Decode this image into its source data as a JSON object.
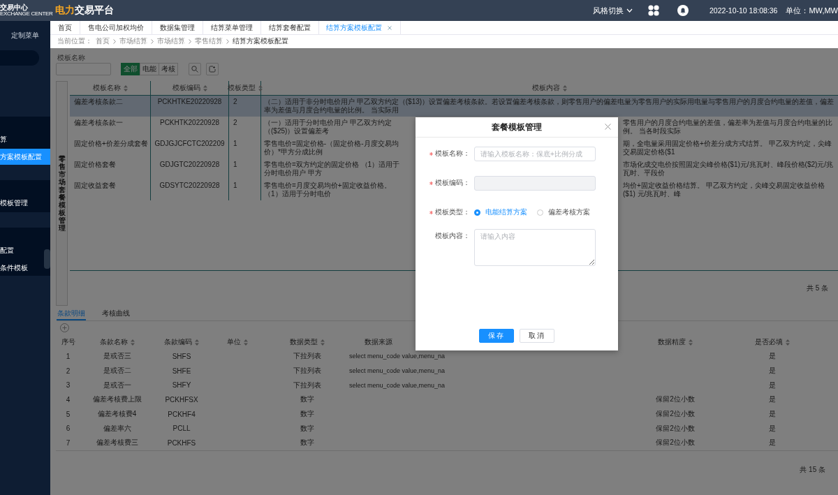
{
  "header": {
    "logo_mark": "交易中心",
    "logo_sub": "EXCHANGE CENTER",
    "brand_highlight": "电力",
    "brand": "交易平台",
    "style_switch": "风格切换",
    "datetime": "2022-10-10 18:08:36",
    "unit": "单位：MW,MW"
  },
  "sidebar": {
    "title": "定制菜单",
    "items": [
      {
        "label": "算",
        "kind": "group",
        "selected": false
      },
      {
        "label": "方案模板配置",
        "kind": "item",
        "selected": true
      },
      {
        "label": "模板管理",
        "kind": "group",
        "selected": false
      },
      {
        "label": "配置",
        "kind": "group",
        "selected": false
      },
      {
        "label": "条件模板",
        "kind": "item",
        "selected": false
      }
    ]
  },
  "tabs": [
    {
      "label": "首页",
      "selected": false,
      "closable": false
    },
    {
      "label": "售电公司加权均价",
      "selected": false,
      "closable": false
    },
    {
      "label": "数据集管理",
      "selected": false,
      "closable": false
    },
    {
      "label": "结算菜单管理",
      "selected": false,
      "closable": false
    },
    {
      "label": "结算套餐配置",
      "selected": false,
      "closable": false
    },
    {
      "label": "结算方案模板配置",
      "selected": true,
      "closable": true
    }
  ],
  "breadcrumb": {
    "label": "当前位置：",
    "items": [
      "首页",
      "市场结算",
      "市场结算",
      "零售结算",
      "结算方案模板配置"
    ]
  },
  "filter": {
    "name_label": "模板名称",
    "type_options": [
      {
        "label": "全部",
        "selected": true
      },
      {
        "label": "电能",
        "selected": false
      },
      {
        "label": "考核",
        "selected": false
      }
    ]
  },
  "template_table": {
    "side_label": "零售市场套餐模板管理",
    "columns": [
      "模板名称",
      "模板编码",
      "模板类型",
      "模板内容"
    ],
    "rows": [
      {
        "name": "偏差考核条款二",
        "code": "PCKHTKE20220928",
        "type": "2",
        "content_start": "（二）适用于非分时电价用户 甲乙双方约定（($13)）设置偏差考核条款。若设置偏差考核条款，则零售用户的偏差电量为零售用户的实际用电量与零售用户的月度合约电量的差值，偏差率为差值与月度合约电量的比例。 当实际用",
        "selected": true
      },
      {
        "name": "偏差考核条款一",
        "code": "PCKHTK20220928",
        "type": "2",
        "content_start": "（一）适用于分时电价用户 甲乙双方约定（($25)）设置偏差考",
        "content_end": "零售用户的月度合约电量的差值，偏差率为差值与月度合约电量的比例。 当各时段实际",
        "selected": false
      },
      {
        "name": "固定价格+价差分成套餐",
        "code": "GDJGJCFCTC202209",
        "type": "1",
        "content_start": "零售电价=固定价格-（固定价格-月度交易均价）*甲方分成比例",
        "content_end": "期，全电量采用固定价格+价差分成方式结算。 甲乙双方约定，尖峰交易固定价格($1",
        "selected": false
      },
      {
        "name": "固定价格套餐",
        "code": "GDJGTC20220928",
        "type": "1",
        "content_start": "零售电价=双方约定的固定价格 （1）适用于分时电价用户 甲方",
        "content_end": "市场化成交电价按照固定尖峰价格($1)元/兆瓦时、峰段价格($2)元/兆瓦时、平段价",
        "selected": false
      },
      {
        "name": "固定收益套餐",
        "code": "GDSYTC20220928",
        "type": "1",
        "content_start": "零售电价=月度交易均价+固定收益价格。（1）适用于分时电价",
        "content_end": "均价+固定收益价格结算。 甲乙双方约定，尖峰交易固定收益价格 ($1) 元/兆瓦时、峰",
        "selected": false
      }
    ],
    "total": "共 5 条"
  },
  "detail_tabs": [
    {
      "label": "条款明细",
      "selected": true
    },
    {
      "label": "考核曲线",
      "selected": false
    }
  ],
  "clause_table": {
    "columns": [
      "序号",
      "条款名称",
      "条款编码",
      "单位",
      "数据类型",
      "数据来源",
      "数据精度",
      "是否必填"
    ],
    "rows": [
      {
        "index": "1",
        "name": "是或否三",
        "code": "SHFS",
        "data_type": "下拉列表",
        "source": "select menu_code value,menu_na",
        "required": "是"
      },
      {
        "index": "2",
        "name": "是或否二",
        "code": "SHFE",
        "data_type": "下拉列表",
        "source": "select menu_code value,menu_na",
        "required": "是"
      },
      {
        "index": "3",
        "name": "是或否一",
        "code": "SHFY",
        "data_type": "下拉列表",
        "source": "select menu_code value,menu_na",
        "required": "是"
      },
      {
        "index": "4",
        "name": "偏差考核费上限",
        "code": "PCKHFSX",
        "data_type": "数字",
        "precision": "保留2位小数",
        "required": "是"
      },
      {
        "index": "5",
        "name": "偏差考核费4",
        "code": "PCKHF4",
        "data_type": "数字",
        "precision": "保留2位小数",
        "required": "是"
      },
      {
        "index": "6",
        "name": "偏差率六",
        "code": "PCLL",
        "data_type": "数字",
        "precision": "保留2位小数",
        "required": "是"
      },
      {
        "index": "7",
        "name": "偏差考核费三",
        "code": "PCKHFS",
        "data_type": "数字",
        "precision": "保留2位小数",
        "required": "是"
      }
    ],
    "total": "共 15 条"
  },
  "dialog": {
    "title": "套餐模板管理",
    "fields": [
      {
        "kind": "text",
        "label": "模板名称：",
        "required": true,
        "placeholder": "请输入模板名称：保底+比例分成",
        "disabled": false
      },
      {
        "kind": "text",
        "label": "模板编码：",
        "required": true,
        "disabled": true
      },
      {
        "kind": "radio",
        "label": "模板类型：",
        "required": true,
        "options": [
          {
            "label": "电能结算方案",
            "selected": true
          },
          {
            "label": "偏差考核方案",
            "selected": false
          }
        ]
      },
      {
        "kind": "textarea",
        "label": "模板内容：",
        "required": false,
        "placeholder": "请输入内容"
      }
    ],
    "buttons": [
      {
        "label": "保存",
        "kind": "primary"
      },
      {
        "label": "取消",
        "kind": "default"
      }
    ]
  }
}
